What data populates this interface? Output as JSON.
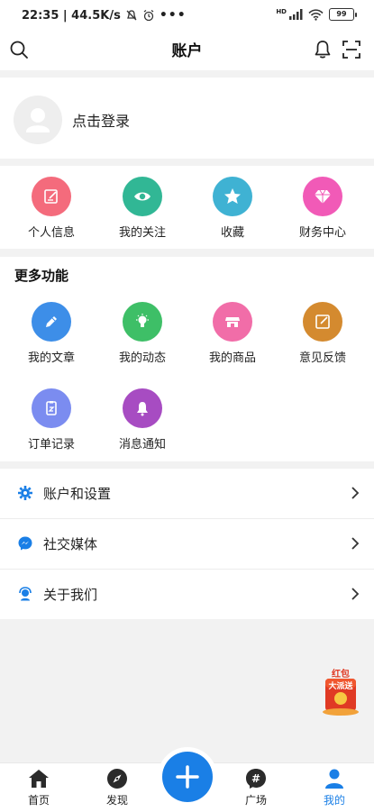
{
  "status_bar": {
    "time_speed": "22:35 | 44.5K/s",
    "network": "HD",
    "battery": "99"
  },
  "header": {
    "title": "账户"
  },
  "profile": {
    "login_text": "点击登录"
  },
  "quick_menu": [
    {
      "label": "个人信息",
      "icon": "edit-icon",
      "color": "#f46b7c"
    },
    {
      "label": "我的关注",
      "icon": "eye-icon",
      "color": "#31b795"
    },
    {
      "label": "收藏",
      "icon": "star-icon",
      "color": "#3fb2d3"
    },
    {
      "label": "财务中心",
      "icon": "diamond-icon",
      "color": "#f15ab7"
    }
  ],
  "more_functions": {
    "title": "更多功能",
    "items": [
      {
        "label": "我的文章",
        "icon": "pencil-icon",
        "color": "#3d8ee8"
      },
      {
        "label": "我的动态",
        "icon": "lightbulb-icon",
        "color": "#3ebf67"
      },
      {
        "label": "我的商品",
        "icon": "store-icon",
        "color": "#f16da8"
      },
      {
        "label": "意见反馈",
        "icon": "feedback-icon",
        "color": "#d48a2f"
      },
      {
        "label": "订单记录",
        "icon": "clipboard-icon",
        "color": "#7b8cf0"
      },
      {
        "label": "消息通知",
        "icon": "bell-icon",
        "color": "#a74cc2"
      }
    ]
  },
  "settings_list": [
    {
      "label": "账户和设置",
      "icon": "gear-icon"
    },
    {
      "label": "社交媒体",
      "icon": "messenger-icon"
    },
    {
      "label": "关于我们",
      "icon": "support-icon"
    }
  ],
  "promo": {
    "text_line1": "红包",
    "text_line2": "大派送"
  },
  "tab_bar": {
    "items": [
      {
        "label": "首页",
        "icon": "home-icon"
      },
      {
        "label": "发现",
        "icon": "compass-icon"
      },
      {
        "label": "广场",
        "icon": "hashtag-icon"
      },
      {
        "label": "我的",
        "icon": "person-icon"
      }
    ],
    "active": "我的"
  },
  "colors": {
    "accent": "#1a7fe6",
    "background": "#f2f2f2"
  }
}
